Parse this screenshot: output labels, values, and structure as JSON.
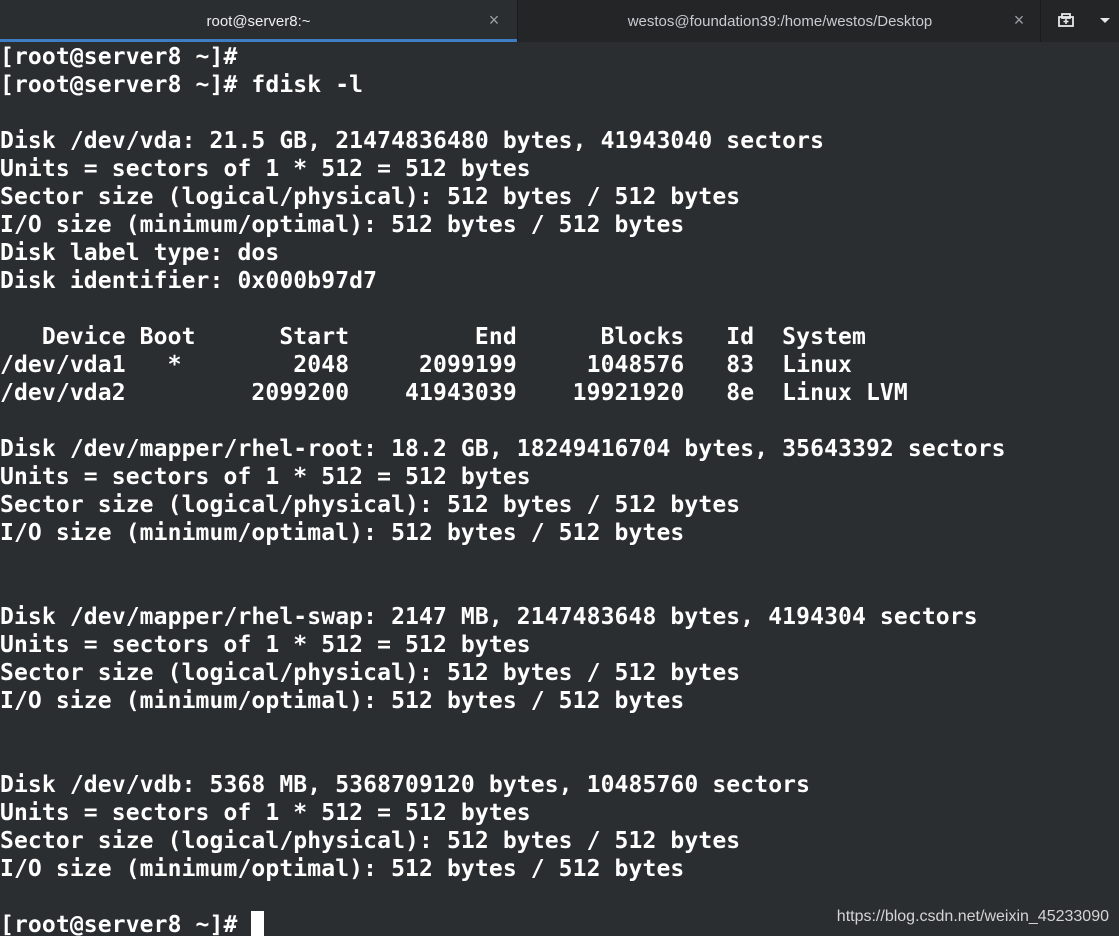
{
  "tabs": [
    {
      "label": "root@server8:~",
      "active": true
    },
    {
      "label": "westos@foundation39:/home/westos/Desktop",
      "active": false
    }
  ],
  "icons": {
    "close": "close-icon",
    "new_tab": "new-tab-icon",
    "menu": "chevron-down-icon"
  },
  "terminal": {
    "lines": [
      "[root@server8 ~]#",
      "[root@server8 ~]# fdisk -l",
      "",
      "Disk /dev/vda: 21.5 GB, 21474836480 bytes, 41943040 sectors",
      "Units = sectors of 1 * 512 = 512 bytes",
      "Sector size (logical/physical): 512 bytes / 512 bytes",
      "I/O size (minimum/optimal): 512 bytes / 512 bytes",
      "Disk label type: dos",
      "Disk identifier: 0x000b97d7",
      "",
      "   Device Boot      Start         End      Blocks   Id  System",
      "/dev/vda1   *        2048     2099199     1048576   83  Linux",
      "/dev/vda2         2099200    41943039    19921920   8e  Linux LVM",
      "",
      "Disk /dev/mapper/rhel-root: 18.2 GB, 18249416704 bytes, 35643392 sectors",
      "Units = sectors of 1 * 512 = 512 bytes",
      "Sector size (logical/physical): 512 bytes / 512 bytes",
      "I/O size (minimum/optimal): 512 bytes / 512 bytes",
      "",
      "",
      "Disk /dev/mapper/rhel-swap: 2147 MB, 2147483648 bytes, 4194304 sectors",
      "Units = sectors of 1 * 512 = 512 bytes",
      "Sector size (logical/physical): 512 bytes / 512 bytes",
      "I/O size (minimum/optimal): 512 bytes / 512 bytes",
      "",
      "",
      "Disk /dev/vdb: 5368 MB, 5368709120 bytes, 10485760 sectors",
      "Units = sectors of 1 * 512 = 512 bytes",
      "Sector size (logical/physical): 512 bytes / 512 bytes",
      "I/O size (minimum/optimal): 512 bytes / 512 bytes",
      ""
    ],
    "prompt": "[root@server8 ~]# "
  },
  "watermark": "https://blog.csdn.net/weixin_45233090"
}
